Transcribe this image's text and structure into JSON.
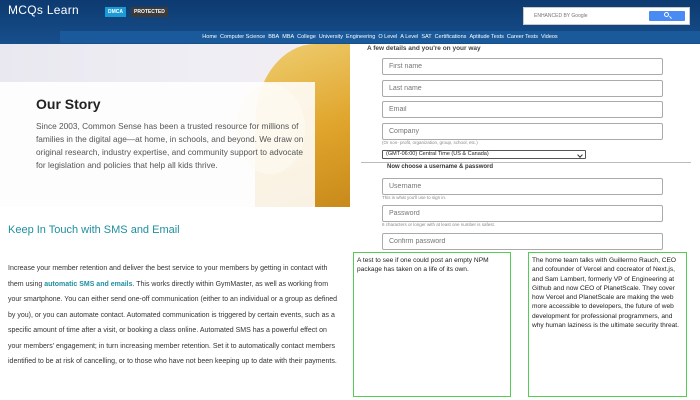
{
  "header": {
    "logo": "MCQs Learn",
    "badge_dmca": "DMCA",
    "badge_protected": "PROTECTED",
    "search_placeholder": "ENHANCED BY Google",
    "nav": [
      "Home",
      "Computer Science",
      "BBA",
      "MBA",
      "College",
      "University",
      "Engineering",
      "O Level",
      "A Level",
      "SAT",
      "Certifications",
      "Aptitude Tests",
      "Career Tests",
      "Videos"
    ]
  },
  "story": {
    "title": "Our Story",
    "text": "Since 2003, Common Sense has been a trusted resource for millions of families in the digital age—at home, in schools, and beyond. We draw on original research, industry expertise, and community support to advocate for legislation and policies that help all kids thrive."
  },
  "sms": {
    "title": "Keep In Touch with SMS and Email",
    "text_before": "Increase your member retention and deliver the best service to your members by getting in contact with them using ",
    "link": "automatic SMS and emails",
    "text_after": ". This works directly within GymMaster, as well as working from your smartphone. You can either send one-off communication (either to an individual or a group as defined by you), or you can automate contact. Automated communication is triggered by certain events, such as a specific amount of time after a visit, or booking a class online. Automated SMS has a powerful effect on your members' engagement; in turn increasing member retention. Set it to automatically contact members identified to be at risk of cancelling, or to those who have not been keeping up to date with their payments."
  },
  "form": {
    "heading": "A few details and you're on your way",
    "first_name": "First name",
    "last_name": "Last name",
    "email": "Email",
    "company": "Company",
    "company_hint": "(Or non- profit, organization, group, school, etc.)",
    "timezone": "(GMT-06:00) Central Time (US & Canada)",
    "username_heading": "Now choose a username & password",
    "username": "Username",
    "username_hint": "This is what you'll use to sign in.",
    "password": "Password",
    "password_hint": "6 characters or longer with at least one number is safest.",
    "confirm_password": "Confirm password"
  },
  "panels": {
    "left": "A test to see if one could post an empty NPM package has taken on a life of its own.",
    "right": "The home team talks with Guillermo Rauch, CEO and cofounder of Vercel and cocreator of Next.js, and Sam Lambert, formerly VP of Engineering at Github and now CEO of PlanetScale. They cover how Vercel and PlanetScale are making the web more accessible to developers, the future of web development for professional programmers, and why human laziness is the ultimate security threat."
  }
}
